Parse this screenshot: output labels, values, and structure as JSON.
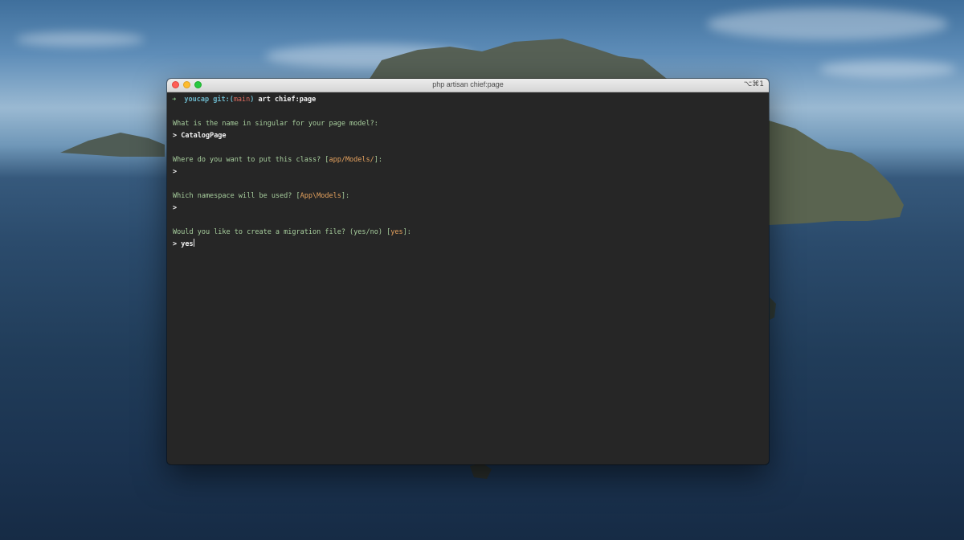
{
  "window": {
    "title": "php artisan chief:page",
    "shortcut": "⌥⌘1"
  },
  "terminal": {
    "prompt_arrow": "➜",
    "dir": "youcap",
    "git_label": "git:(",
    "branch": "main",
    "git_close": ")",
    "command": "art chief:page",
    "q1": "What is the name in singular for your page model?:",
    "a1_marker": ">",
    "a1": "CatalogPage",
    "q2_text": "Where do you want to put this class? [",
    "q2_default": "app/Models/",
    "q2_close": "]:",
    "a2_marker": ">",
    "q3_text": "Which namespace will be used? [",
    "q3_default": "App\\Models",
    "q3_close": "]:",
    "a3_marker": ">",
    "q4_text": "Would you like to create a migration file? (yes/no) [",
    "q4_default": "yes",
    "q4_close": "]:",
    "a4_marker": ">",
    "a4": "yes"
  },
  "colors": {
    "prompt_green": "#8bc98b",
    "git_cyan": "#6bb5c8",
    "branch_red": "#e06c5f",
    "default_orange": "#e5a25e",
    "background": "#262626"
  }
}
